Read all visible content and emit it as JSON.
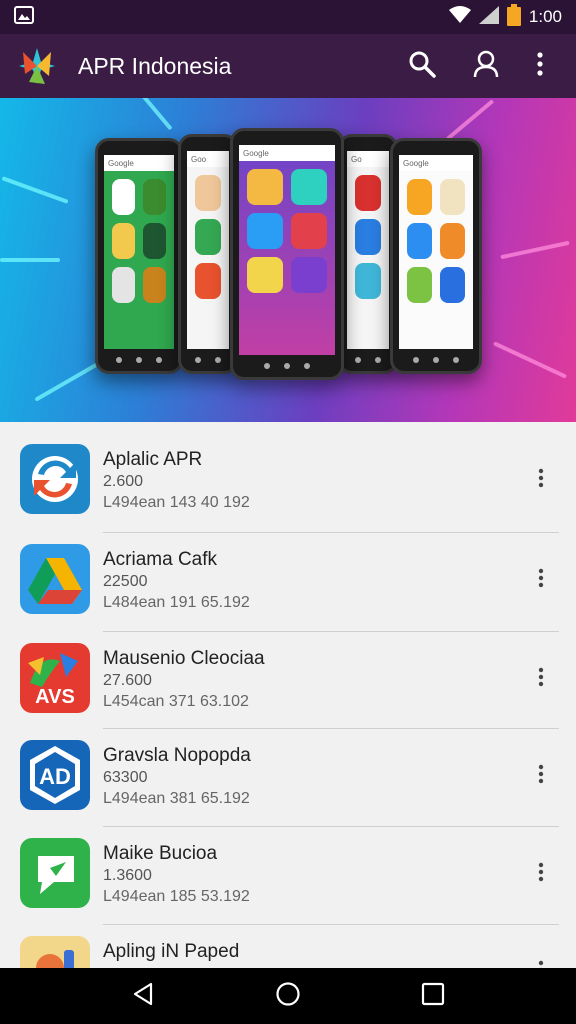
{
  "status_bar": {
    "time": "1:00",
    "icons": [
      "image-notification-icon",
      "wifi-icon",
      "signal-icon",
      "battery-icon"
    ]
  },
  "app_bar": {
    "title": "APR Indonesia",
    "actions": [
      "search-icon",
      "account-icon",
      "more-vert-icon"
    ],
    "background": "#3a1c44"
  },
  "banner": {
    "description_icon": "promo-phones-banner"
  },
  "apps": [
    {
      "name": "Aplalic APR",
      "size": "2.600",
      "meta": "L494ean 143 40 192",
      "icon": "sync-arrows-icon"
    },
    {
      "name": "Acriama Cafk",
      "size": "22500",
      "meta": "L484ean 191 65.192",
      "icon": "drive-triangle-icon"
    },
    {
      "name": "Mausenio Cleociaa",
      "size": "27.600",
      "meta": "L454can 371 63.102",
      "icon": "avs-icon"
    },
    {
      "name": "Gravsla Nopopda",
      "size": "63300",
      "meta": "L494ean 381 65.192",
      "icon": "ad-badge-icon"
    },
    {
      "name": "Maike Bucioa",
      "size": "1.3600",
      "meta": "L494ean 185 53.192",
      "icon": "chat-bubble-icon"
    },
    {
      "name": "Apling iN Paped",
      "size": "",
      "meta": "",
      "icon": "cartoon-icon"
    }
  ],
  "colors": {
    "accent": "#3a1c44",
    "list_background": "#f1f1f1",
    "battery": "#f5a623"
  }
}
